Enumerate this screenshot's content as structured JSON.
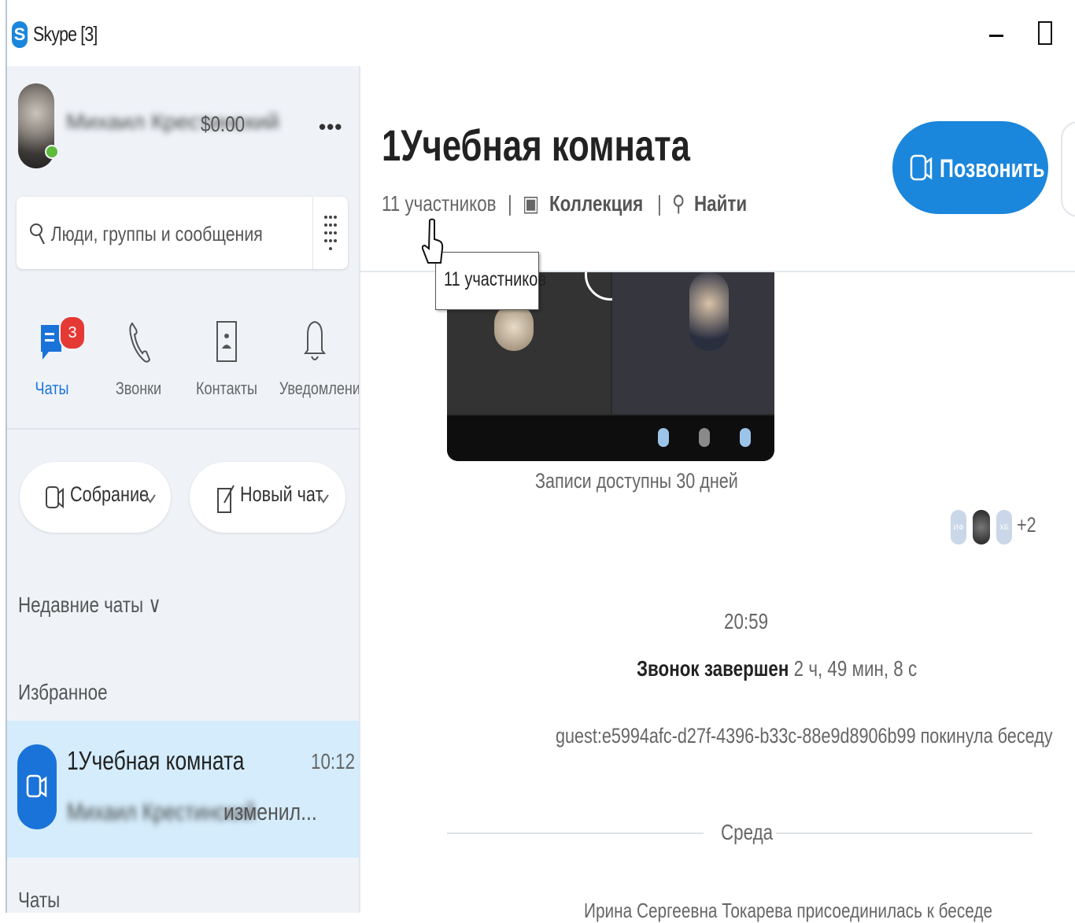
{
  "window": {
    "title": "Skype [3]"
  },
  "profile": {
    "name": "Михаил Крестинский",
    "balance": "$0.00"
  },
  "search": {
    "placeholder": "Люди, группы и сообщения"
  },
  "nav": {
    "chats": "Чаты",
    "chats_badge": "3",
    "calls": "Звонки",
    "contacts": "Контакты",
    "notifications": "Уведомления"
  },
  "actions": {
    "meeting": "Собрание",
    "new_chat": "Новый чат"
  },
  "sections": {
    "recent": "Недавние чаты ∨",
    "favorites": "Избранное",
    "chats": "Чаты"
  },
  "chat_list": [
    {
      "name": "1Учебная комната",
      "time": "10:12",
      "preview_author": "Михаил Крестинский",
      "preview_text": "изменил..."
    }
  ],
  "conversation": {
    "title": "1Учебная комната",
    "participants": "11 участников",
    "collection": "Коллекция",
    "find": "Найти",
    "call_button": "Позвонить",
    "tooltip": "11 участников",
    "recording_caption": "Записи доступны 30 дней",
    "seen_more": "+2",
    "seen_avatar_1": "ИФ",
    "seen_avatar_3": "ХБ",
    "time": "20:59",
    "call_ended": "Звонок завершен",
    "call_duration": "2 ч, 49 мин, 8 с",
    "left_message": "guest:e5994afc-d27f-4396-b33c-88e9d8906b99 покинула беседу",
    "day_separator": "Среда",
    "joined_message": "Ирина Сергеевна Токарева присоединилась к беседе"
  },
  "colors": {
    "accent": "#1a86dc",
    "sidebar_bg": "#eff3f8",
    "selected_chat": "#d4ecfb",
    "badge": "#e53935"
  }
}
